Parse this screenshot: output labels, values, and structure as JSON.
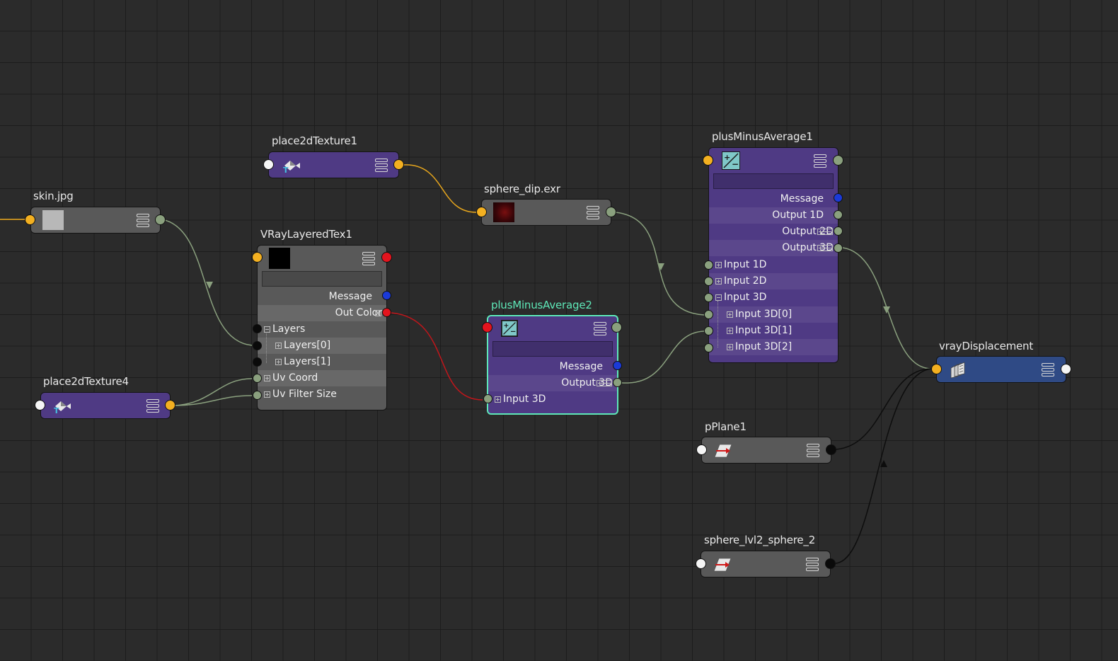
{
  "nodes": {
    "skin": {
      "title": "skin.jpg"
    },
    "place2dTexture1": {
      "title": "place2dTexture1"
    },
    "sphere_dip": {
      "title": "sphere_dip.exr"
    },
    "vrayLayeredTex": {
      "title": "VRayLayeredTex1",
      "attrs": {
        "message": "Message",
        "out_color": "Out Color",
        "layers": "Layers",
        "layers0": "Layers[0]",
        "layers1": "Layers[1]",
        "uv_coord": "Uv Coord",
        "uv_filter": "Uv Filter Size"
      }
    },
    "place2dTexture4": {
      "title": "place2dTexture4"
    },
    "pma2": {
      "title": "plusMinusAverage2",
      "attrs": {
        "message": "Message",
        "output3d": "Output 3D",
        "input3d": "Input 3D"
      }
    },
    "pma1": {
      "title": "plusMinusAverage1",
      "attrs": {
        "message": "Message",
        "output1d": "Output 1D",
        "output2d": "Output 2D",
        "output3d": "Output 3D",
        "input1d": "Input 1D",
        "input2d": "Input 2D",
        "input3d": "Input 3D",
        "input3d0": "Input 3D[0]",
        "input3d1": "Input 3D[1]",
        "input3d2": "Input 3D[2]"
      }
    },
    "vrayDisplacement": {
      "title": "vrayDisplacement"
    },
    "pPlane1": {
      "title": "pPlane1"
    },
    "sphere_lvl2": {
      "title": "sphere_lvl2_sphere_2"
    }
  },
  "colors": {
    "background": "#2b2b2b",
    "grid": "#1c1c1c",
    "node_purple": "#4f3a84",
    "node_gray": "#595959",
    "node_blue": "#2f4a85",
    "selection": "#5ee8b8",
    "wire_default": "#8aa07e",
    "wire_color": "#c0161b",
    "wire_uv": "#e5a51d",
    "wire_geo": "#0d0d0d"
  },
  "icons": [
    "texture-thumbnail-icon",
    "place2d-texture-icon",
    "plus-minus-icon",
    "displacement-icon",
    "mesh-shape-icon",
    "attribute-list-icon"
  ]
}
